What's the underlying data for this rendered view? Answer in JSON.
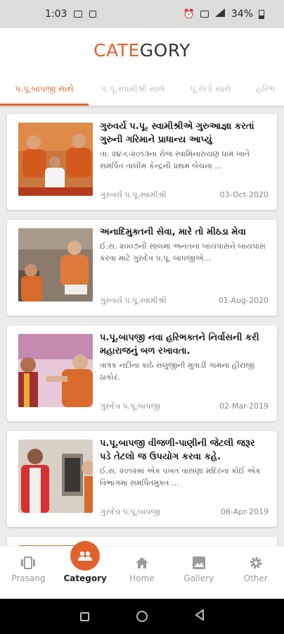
{
  "status_bar": {
    "time": "1:03",
    "battery": "34%"
  },
  "header": {
    "title_accent": "CATE",
    "title_rest": "GORY"
  },
  "tabs": [
    {
      "label": "પ.પૂ.બાપજી સાથે"
    },
    {
      "label": "પ.પૂ.સ્વામીશ્રી સાથે"
    },
    {
      "label": "પૂ.સંતો સાથે"
    },
    {
      "label": "હરિભ"
    }
  ],
  "cards": [
    {
      "title": "ગુરુવર્ય પ.પૂ. સ્વામીશ્રીએ ગુરુઆજ્ઞા કરતાં ગુરુની ગરિમાને પ્રાધાન્ય આપ્યું",
      "excerpt": "તા. ૨૪-૬-૨૦૧૩ના રોજ સ્વામિનારાયણ ધામ ખાતે સમર્પિત તાલીમ કેન્દ્રની પ્રથમ બેચના ...",
      "tag": "ગુરુવર્ય પ.પૂ.સ્વામીશ્રી",
      "date": "03-Oct-2020"
    },
    {
      "title": "અનાદિમુક્તની સેવા, મારે તો મીઠડા મેવા",
      "excerpt": "ઈ.સ. ૨૦૦૭ની સાલમાં અનંતના બાયપાસને બાયપાસ કરવા માટે ગુરુદેવ પ.પૂ. બાપજીએ...",
      "tag": "ગુરુવર્ય પ.પૂ.સ્વામીશ્રી",
      "date": "01-Aug-2020"
    },
    {
      "title": "પ.પૂ.બાપજી નવા હરિભક્તને નિર્વાસની કરી મહારાજનું બળ રખાવતા.",
      "excerpt": "વાત્રક નદીના કાંઠે સલુજીની મુવાડી ગામના હીરાજી ઠાકોર.",
      "tag": "ગુરુદેવ પ.પૂ.બાપજી",
      "date": "02-Mar-2019"
    },
    {
      "title": "પ.પૂ.બાપજી વીજળી-પાણીની જેટલી જરૂર પડે તેટલો જ ઉપયોગ કરવા કહે.",
      "excerpt": "ઈ.સ. ૨૦૧૨માં એક વખત વાસણા મંદિરના કોઈ એક વિભાગમાં સમર્પિતમુક્ત ...",
      "tag": "ગુરુદેવ પ.પૂ.બાપજી",
      "date": "06-Apr-2019"
    }
  ],
  "bottom_nav": [
    {
      "label": "Prasang",
      "icon": "prasang-icon"
    },
    {
      "label": "Category",
      "icon": "people-icon"
    },
    {
      "label": "Home",
      "icon": "home-icon"
    },
    {
      "label": "Gallery",
      "icon": "gallery-icon"
    },
    {
      "label": "Other",
      "icon": "gear-icon"
    }
  ],
  "colors": {
    "accent": "#e2612a",
    "background": "#ececec"
  }
}
